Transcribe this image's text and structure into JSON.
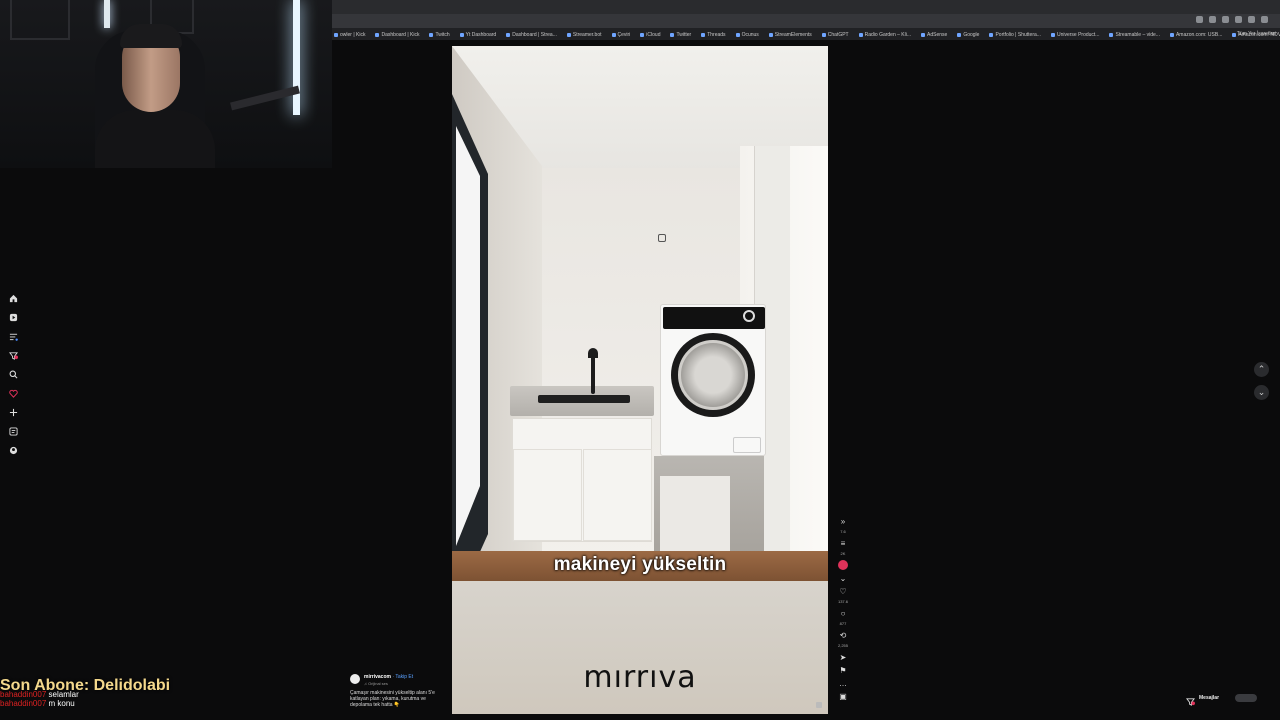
{
  "browser": {
    "bookmarks": [
      "owler | Kick",
      "Dashboard | Kick",
      "Twitch",
      "Yt Dashboard",
      "Dashboard | Strea...",
      "Streamer.bot",
      "Çeviri",
      "iCloud",
      "Twitter",
      "Threads",
      "Ocunus",
      "StreamElements",
      "ChatGPT",
      "Radio Garden – Kli...",
      "AdSense",
      "Google",
      "Portfolio | Shuttera...",
      "Universe Product...",
      "Streamable – vide...",
      "Amazon.com: USB...",
      "Amazon.com: NOV...",
      "Submit a request",
      "Drive & Linker"
    ],
    "bookmarks_right": "Tüm Yer İşaretleri"
  },
  "video": {
    "caption": "makineyi yükseltin",
    "watermark": "mırrıva"
  },
  "rail": {
    "counts": [
      "7.6",
      "2K",
      "137.6",
      "877",
      "2,255"
    ]
  },
  "post": {
    "username": "mirrivacom",
    "follow": "· Takip Et",
    "sound": "♫ Orijinal ses",
    "description": "Çamaşır makinesini yükseltip alanı 5'e katlayan plan: yıkama, kurutma ve depolama tek hatta 👇"
  },
  "messages": {
    "label": "Mesajlar"
  },
  "overlay": {
    "last_sub_label": "Son Abone: Delidolabi",
    "chat": [
      {
        "user": "bahaddin007",
        "msg": "selamlar"
      },
      {
        "user": "bahaddin007",
        "msg": "m konu"
      }
    ]
  },
  "colors": {
    "accent": "#e0325a",
    "sub_text": "#f4d88c",
    "chat_user": "#dd2222"
  }
}
